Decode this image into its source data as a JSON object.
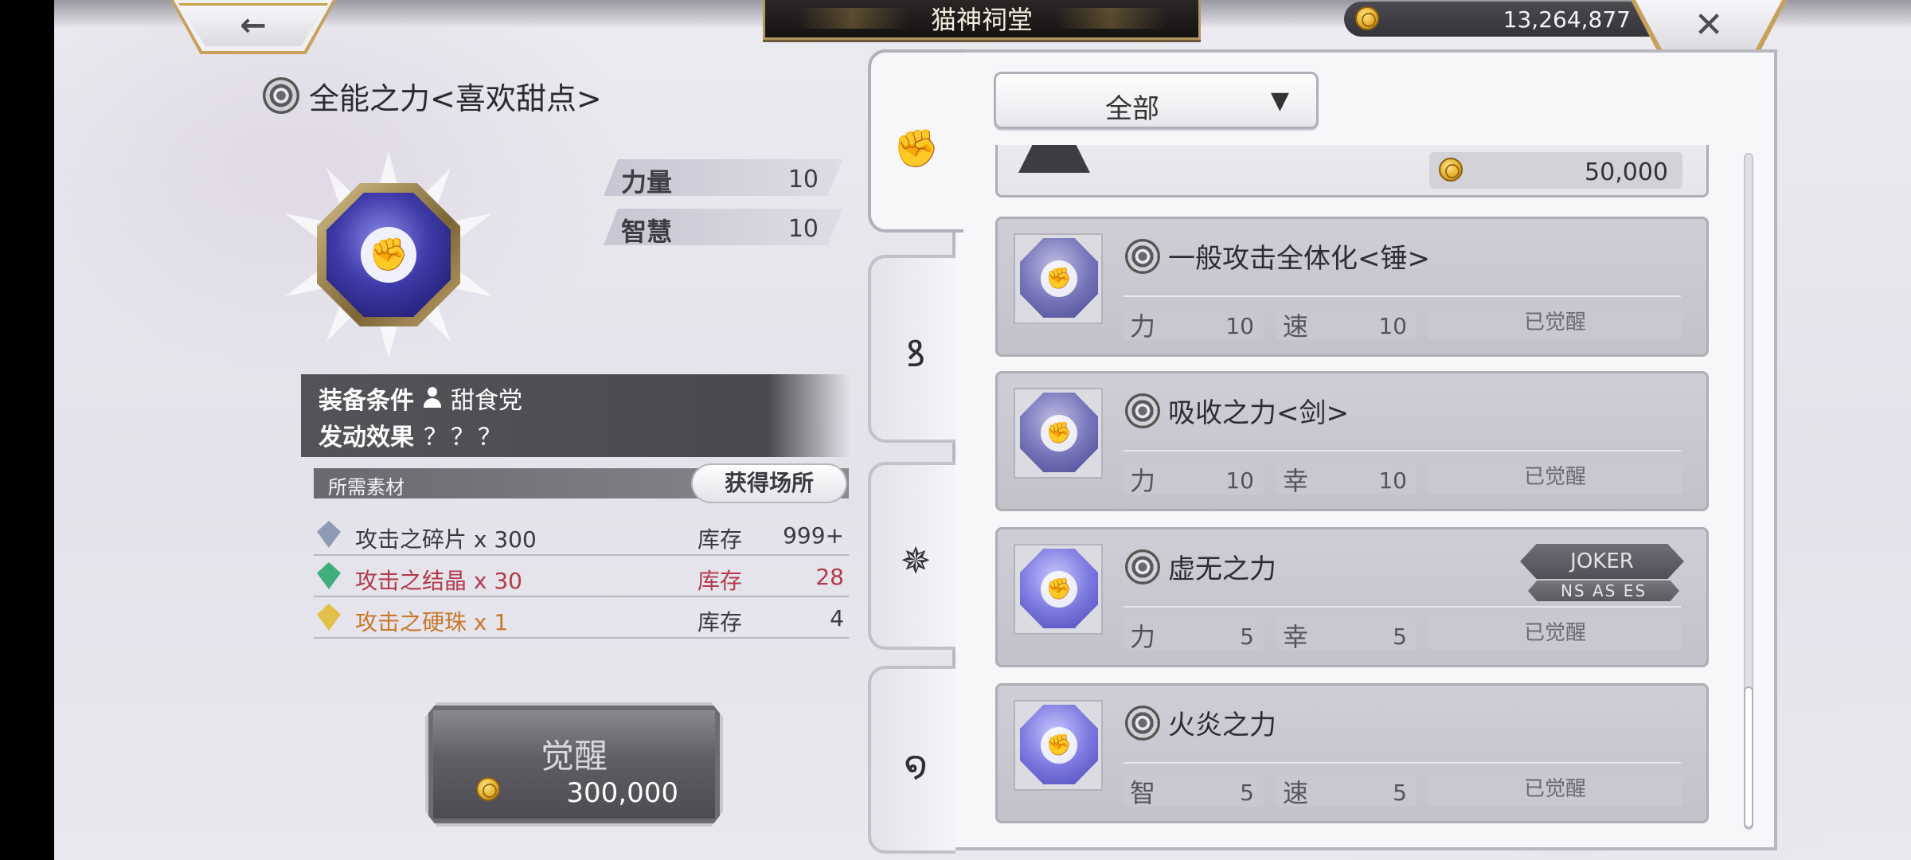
{
  "header": {
    "title": "猫神祠堂",
    "coins": "13,264,877",
    "back_icon": "←",
    "close_icon": "✕"
  },
  "skill": {
    "title": "全能之力<喜欢甜点>",
    "stats": [
      {
        "label": "力量",
        "value": "10"
      },
      {
        "label": "智慧",
        "value": "10"
      }
    ],
    "equip_condition_label": "装备条件",
    "equip_condition_value": "甜食党",
    "trigger_effect_label": "发动效果",
    "trigger_effect_value": "？？？"
  },
  "materials": {
    "header": "所需素材",
    "obtain_button": "获得场所",
    "items": [
      {
        "name": "攻击之碎片 x 300",
        "stock_label": "库存",
        "stock": "999+",
        "color": "#3a393f",
        "gem": "#8f9bb4"
      },
      {
        "name": "攻击之结晶 x 30",
        "stock_label": "库存",
        "stock": "28",
        "color": "#b33a4c",
        "gem": "#3fae7b"
      },
      {
        "name": "攻击之硬珠 x 1",
        "stock_label": "库存",
        "stock": "4",
        "color": "#c8792a",
        "gem": "#e3c04a"
      }
    ]
  },
  "awaken": {
    "label": "觉醒",
    "cost": "300,000"
  },
  "tabs": [
    {
      "icon": "fist-icon",
      "glyph": "✊",
      "active": true
    },
    {
      "icon": "swirl-icon",
      "glyph": "ꝸ",
      "active": false
    },
    {
      "icon": "burst-icon",
      "glyph": "✵",
      "active": false
    },
    {
      "icon": "vortex-icon",
      "glyph": "໑",
      "active": false
    }
  ],
  "filter": {
    "label": "全部",
    "arrow": "▼"
  },
  "list": {
    "first_cost": "50,000",
    "cards": [
      {
        "title": "一般攻击全体化<锤>",
        "stat1_k": "力",
        "stat1_v": "10",
        "stat2_k": "速",
        "stat2_v": "10",
        "status": "已觉醒",
        "joker": false
      },
      {
        "title": "吸收之力<剑>",
        "stat1_k": "力",
        "stat1_v": "10",
        "stat2_k": "幸",
        "stat2_v": "10",
        "status": "已觉醒",
        "joker": false
      },
      {
        "title": "虚无之力",
        "stat1_k": "力",
        "stat1_v": "5",
        "stat2_k": "幸",
        "stat2_v": "5",
        "status": "已觉醒",
        "joker": true,
        "joker_label": "JOKER",
        "joker_sub": "NS AS ES"
      },
      {
        "title": "火炎之力",
        "stat1_k": "智",
        "stat1_v": "5",
        "stat2_k": "速",
        "stat2_v": "5",
        "status": "已觉醒",
        "joker": false
      }
    ]
  },
  "colors": {
    "accent_gold": "#c7a15a",
    "panel_bg": "#f7f6f9",
    "card_bg": "#cfcdd5"
  }
}
